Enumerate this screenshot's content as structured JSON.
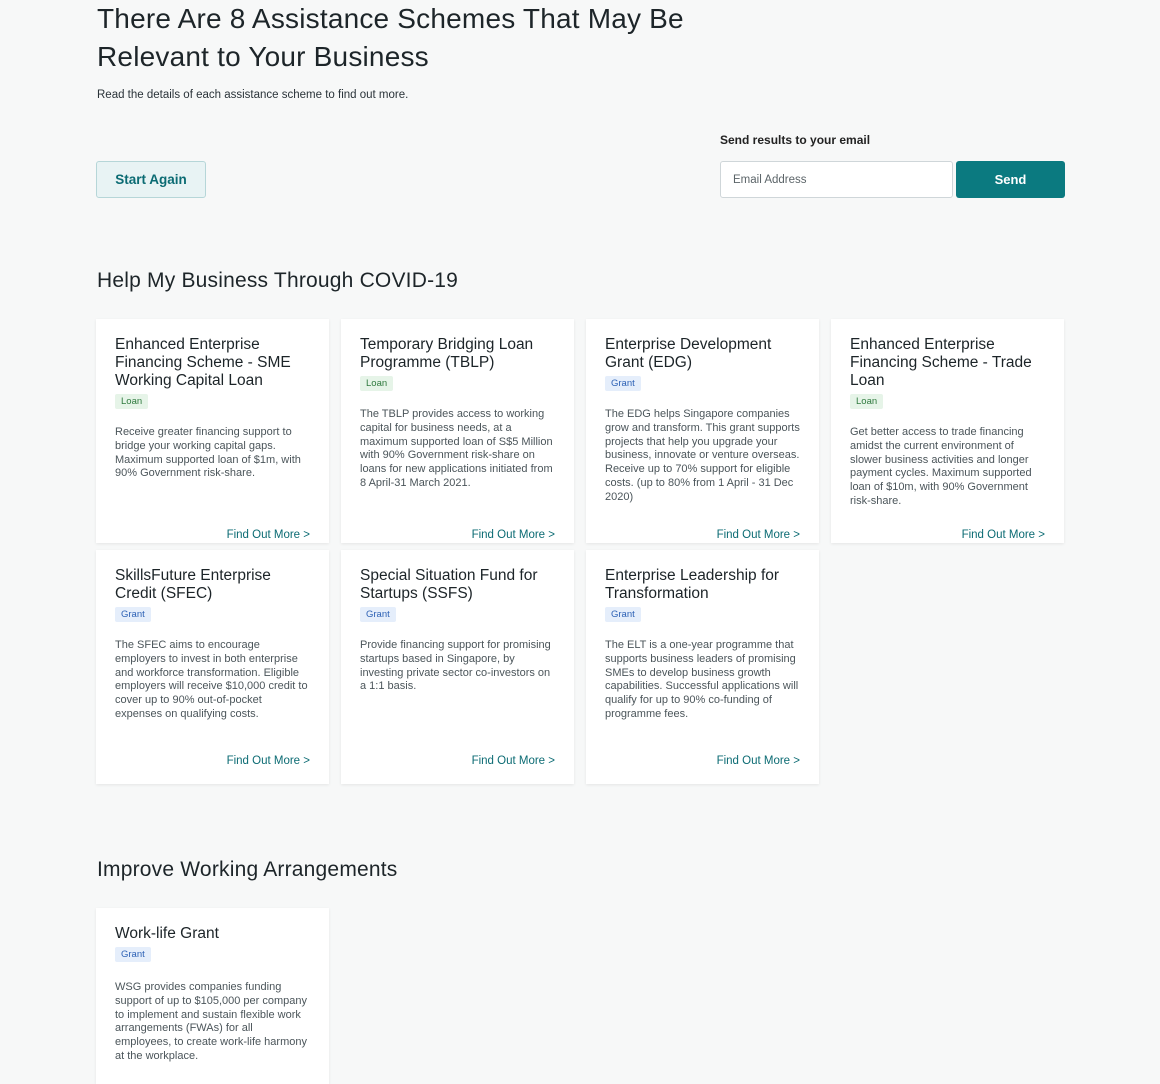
{
  "header": {
    "title": "There Are 8 Assistance Schemes That May Be Relevant to Your Business",
    "subtitle": "Read the details of each assistance scheme to find out more."
  },
  "actions": {
    "start_again_label": "Start Again",
    "email_label": "Send results to your email",
    "email_placeholder": "Email Address",
    "email_value": "",
    "send_label": "Send"
  },
  "sections": [
    {
      "title": "Help My Business Through COVID-19",
      "cards": [
        {
          "title": "Enhanced Enterprise Financing Scheme - SME Working Capital Loan",
          "badge": "Loan",
          "description": "Receive greater financing support to bridge your working capital gaps. Maximum supported loan of $1m, with 90% Government risk-share.",
          "link": "Find Out More >"
        },
        {
          "title": "Temporary Bridging Loan Programme (TBLP)",
          "badge": "Loan",
          "description": "The TBLP provides access to working capital for business needs, at a maximum supported loan of S$5 Million with 90% Government risk-share on loans for new applications initiated from 8 April-31 March 2021.",
          "link": "Find Out More >"
        },
        {
          "title": "Enterprise Development Grant (EDG)",
          "badge": "Grant",
          "description": "The EDG helps Singapore companies grow and transform. This grant supports projects that help you upgrade your business, innovate or venture overseas. Receive up to 70% support for eligible costs. (up to 80% from 1 April - 31 Dec 2020)",
          "link": "Find Out More >"
        },
        {
          "title": "Enhanced Enterprise Financing Scheme - Trade Loan",
          "badge": "Loan",
          "description": "Get better access to trade financing amidst the current environment of slower business activities and longer payment cycles. Maximum supported loan of $10m, with 90% Government risk-share.",
          "link": "Find Out More >"
        },
        {
          "title": "SkillsFuture Enterprise Credit (SFEC)",
          "badge": "Grant",
          "description": "The SFEC aims to encourage employers to invest in both enterprise and workforce transformation. Eligible employers will receive $10,000 credit to cover up to 90% out-of-pocket expenses on qualifying costs.",
          "link": "Find Out More >"
        },
        {
          "title": "Special Situation Fund for Startups (SSFS)",
          "badge": "Grant",
          "description": "Provide financing support for promising startups based in Singapore, by investing private sector co-investors on a 1:1 basis.",
          "link": "Find Out More >"
        },
        {
          "title": "Enterprise Leadership for Transformation",
          "badge": "Grant",
          "description": "The ELT is a one-year programme that supports business leaders of promising SMEs to develop business growth capabilities. Successful applications will qualify for up to 90% co-funding of programme fees.",
          "link": "Find Out More >"
        }
      ]
    },
    {
      "title": "Improve Working Arrangements",
      "cards": [
        {
          "title": "Work-life Grant",
          "badge": "Grant",
          "description": "WSG provides companies funding support of up to $105,000 per company to implement and sustain flexible work arrangements (FWAs) for all employees, to create work-life harmony at the workplace.",
          "link": ""
        }
      ]
    }
  ]
}
